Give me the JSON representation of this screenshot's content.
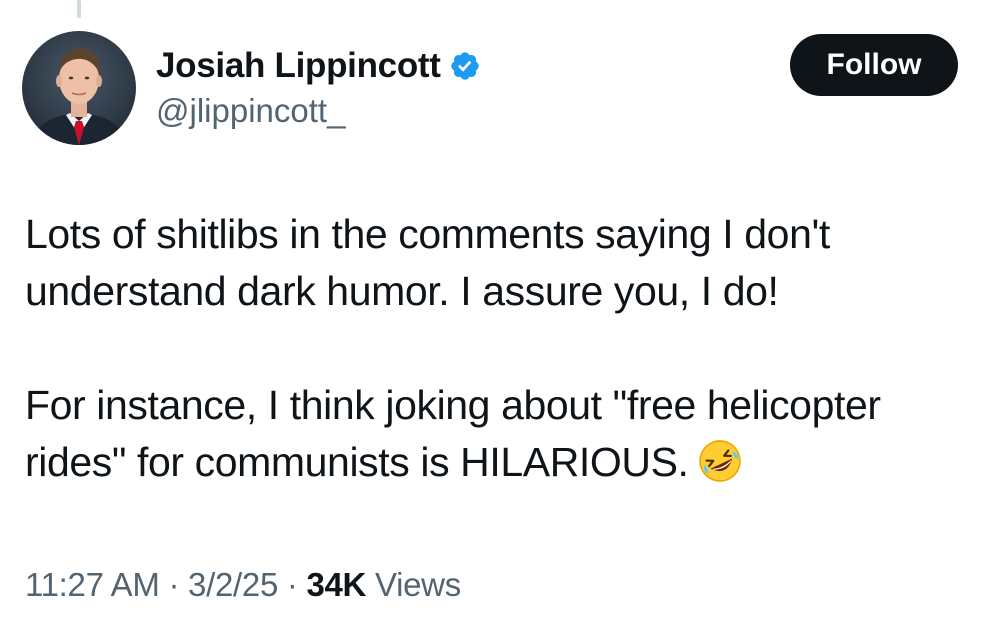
{
  "author": {
    "display_name": "Josiah Lippincott",
    "handle": "@jlippincott_",
    "verified": true,
    "avatar_icon": "profile-photo"
  },
  "follow_button": {
    "label": "Follow"
  },
  "tweet": {
    "paragraphs": [
      {
        "lines": [
          "Lots of shitlibs in the comments saying I don't",
          "understand dark humor. I assure you, I do!"
        ]
      },
      {
        "lines": [
          "For instance, I think joking about \"free helicopter",
          "rides\" for communists is HILARIOUS."
        ],
        "trailing_emoji": "rolling-on-floor-laughing-emoji"
      }
    ]
  },
  "meta": {
    "time": "11:27 AM",
    "separator": "·",
    "date": "3/2/25",
    "views_count": "34K",
    "views_label": "Views"
  },
  "colors": {
    "primary_text": "#0f1419",
    "secondary_text": "#536471",
    "verified_badge": "#1d9bf0",
    "button_bg": "#0f1419",
    "button_text": "#ffffff"
  }
}
